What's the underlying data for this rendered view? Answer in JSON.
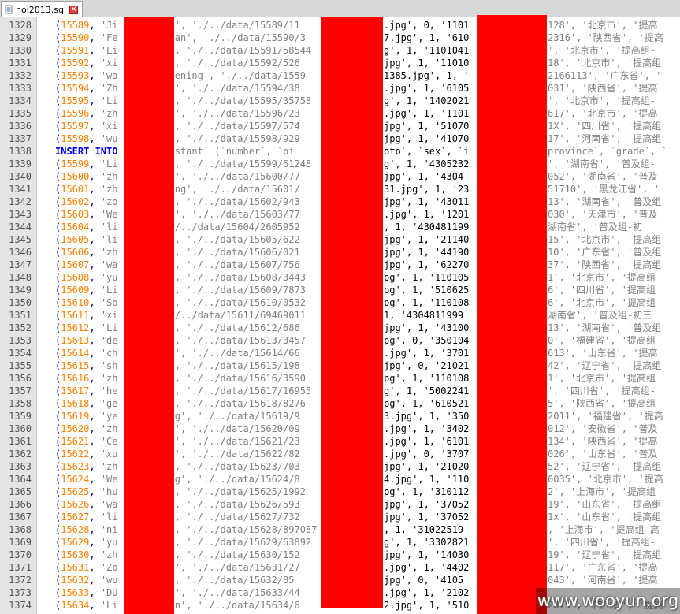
{
  "tab": {
    "label": "noi2013.sql",
    "doc_icon": "document-icon",
    "close_icon": "close-icon"
  },
  "colors": {
    "number": "#ff8000",
    "string": "#808080",
    "keyword": "#0000ff",
    "text": "#000080",
    "redaction": "#ff0000"
  },
  "watermark": "www.wooyun.org",
  "lines": [
    {
      "n": "1328",
      "id": "15589",
      "name": "'Ji",
      "path": "i', './../data/15589/11",
      "mid": ".jpg', 0, '1101",
      "tail": "128', '北京市', '提高"
    },
    {
      "n": "1329",
      "id": "15590",
      "name": "'Fe",
      "path": "yan', './../data/15590/3",
      "mid": "7.jpg', 1, '610",
      "tail": "2316', '陕西省', '提高"
    },
    {
      "n": "1330",
      "id": "15591",
      "name": "'Li",
      "path": "', './../data/15591/58544",
      "mid": "g', 1, '1101041",
      "tail": "', '北京市', '提高组-"
    },
    {
      "n": "1331",
      "id": "15592",
      "name": "'xi",
      "path": "', './../data/15592/526",
      "mid": "jpg', 1, '11010",
      "tail": "18', '北京市', '提高组"
    },
    {
      "n": "1332",
      "id": "15593",
      "name": "'wa",
      "path": "eening', './../data/1559",
      "mid": "1385.jpg', 1, '",
      "tail": "2166113', '广东省', '"
    },
    {
      "n": "1333",
      "id": "15594",
      "name": "'Zh",
      "path": "n', './../data/15594/38",
      "mid": ".jpg', 1, '6105",
      "tail": "031', '陕西省', '提高"
    },
    {
      "n": "1334",
      "id": "15595",
      "name": "'Li",
      "path": "', './../data/15595/35758",
      "mid": "g', 1, '1402021",
      "tail": "', '北京市', '提高组-"
    },
    {
      "n": "1335",
      "id": "15596",
      "name": "'zh",
      "path": "u', './../data/15596/23",
      "mid": ".jpg', 1, '1101",
      "tail": "617', '北京市', '提高"
    },
    {
      "n": "1336",
      "id": "15597",
      "name": "'xi",
      "path": "', './../data/15597/574",
      "mid": "jpg', 1, '51070",
      "tail": "1X', '四川省', '提高组"
    },
    {
      "n": "1337",
      "id": "15598",
      "name": "'wu",
      "path": "', './../data/15598/929",
      "mid": "jpg', 1, '41070",
      "tail": "17', '河南省', '提高组"
    },
    {
      "n": "1338",
      "insert": "INSERT INTO",
      "path": "testant` (`number`, `pi",
      "mid": "oto`, `sex`, `i",
      "tail": "province`, `grade`, `"
    },
    {
      "n": "1339",
      "id": "15599",
      "name": "'Li",
      "path": "', './../data/15599/61248",
      "mid": "g', 1, '4305232",
      "tail": "', '湖南省', '普及组-"
    },
    {
      "n": "1340",
      "id": "15600",
      "name": "'zh",
      "path": "o', './../data/15600/77",
      "mid": "jpg', 1, '4304",
      "tail": "052', '湖南省', '普及"
    },
    {
      "n": "1341",
      "id": "15601",
      "name": "'zh",
      "path": "eng', './../data/15601/",
      "mid": "31.jpg', 1, '23",
      "tail": "51710', '黑龙江省', '"
    },
    {
      "n": "1342",
      "id": "15602",
      "name": "'zo",
      "path": "', './../data/15602/943",
      "mid": "jpg', 1, '43011",
      "tail": "13', '湖南省', '普及组"
    },
    {
      "n": "1343",
      "id": "15603",
      "name": "'We",
      "path": "n', './../data/15603/77",
      "mid": ".jpg', 1, '1201",
      "tail": "030', '天津市', '普及"
    },
    {
      "n": "1344",
      "id": "15604",
      "name": "'li",
      "path": "./../data/15604/2605952",
      "mid": ", 1, '430481199",
      "tail": "湖南省', '普及组-初"
    },
    {
      "n": "1345",
      "id": "15605",
      "name": "'li",
      "path": "', './../data/15605/622",
      "mid": "jpg', 1, '21140",
      "tail": "15', '北京市', '提高组"
    },
    {
      "n": "1346",
      "id": "15606",
      "name": "'zh",
      "path": "', './../data/15606/021",
      "mid": "jpg', 1, '44190",
      "tail": "10', '广东省', '普及组"
    },
    {
      "n": "1347",
      "id": "15607",
      "name": "'wa",
      "path": "', './../data/15607/756",
      "mid": "jpg', 1, '62270",
      "tail": "37', '陕西省', '提高组"
    },
    {
      "n": "1348",
      "id": "15608",
      "name": "'yu",
      "path": "', './../data/15608/3443",
      "mid": "pg', 1, '110105",
      "tail": "1', '北京市', '提高组"
    },
    {
      "n": "1349",
      "id": "15609",
      "name": "'Li",
      "path": "', './../data/15609/7873",
      "mid": "pg', 1, '510625",
      "tail": "6', '四川省', '提高组"
    },
    {
      "n": "1350",
      "id": "15610",
      "name": "'So",
      "path": "', './../data/15610/0532",
      "mid": "pg', 1, '110108",
      "tail": "6', '北京市', '提高组"
    },
    {
      "n": "1351",
      "id": "15611",
      "name": "'xi",
      "path": "./../data/15611/69469011",
      "mid": "1, '4304811999",
      "tail": "湖南省', '普及组-初三"
    },
    {
      "n": "1352",
      "id": "15612",
      "name": "'Li",
      "path": "', './../data/15612/686",
      "mid": "jpg', 1, '43100",
      "tail": "13', '湖南省', '普及组"
    },
    {
      "n": "1353",
      "id": "15613",
      "name": "'de",
      "path": "', './../data/15613/3457",
      "mid": "pg', 0, '350104",
      "tail": "0', '福建省', '提高组"
    },
    {
      "n": "1354",
      "id": "15614",
      "name": "'ch",
      "path": "a', './../data/15614/66",
      "mid": ".jpg', 1, '3701",
      "tail": "613', '山东省', '提高"
    },
    {
      "n": "1355",
      "id": "15615",
      "name": "'sh",
      "path": "', './../data/15615/198",
      "mid": "jpg', 0, '21021",
      "tail": "42', '辽宁省', '提高组"
    },
    {
      "n": "1356",
      "id": "15616",
      "name": "'zh",
      "path": "', './../data/15616/3590",
      "mid": "pg', 1, '110108",
      "tail": "1', '北京市', '提高组"
    },
    {
      "n": "1357",
      "id": "15617",
      "name": "'he",
      "path": "', './../data/15617/16955",
      "mid": "g', 1, '5002241",
      "tail": "', '四川省', '提高组-"
    },
    {
      "n": "1358",
      "id": "15618",
      "name": "'ge",
      "path": "', './../data/15618/8276",
      "mid": "pg', 1, '610521",
      "tail": "5', '陕西省', '提高组"
    },
    {
      "n": "1359",
      "id": "15619",
      "name": "'ye",
      "path": "ng', './../data/15619/9",
      "mid": "3.jpg', 1, '350",
      "tail": "2011', '福建省', '提高"
    },
    {
      "n": "1360",
      "id": "15620",
      "name": "'zh",
      "path": "g', './../data/15620/09",
      "mid": ".jpg', 1, '3402",
      "tail": "012', '安徽省', '普及"
    },
    {
      "n": "1361",
      "id": "15621",
      "name": "'Ce",
      "path": "g', './../data/15621/23",
      "mid": ".jpg', 1, '6101",
      "tail": "134', '陕西省', '提高"
    },
    {
      "n": "1362",
      "id": "15622",
      "name": "'xu",
      "path": "n', './../data/15622/82",
      "mid": ".jpg', 0, '3707",
      "tail": "026', '山东省', '普及"
    },
    {
      "n": "1363",
      "id": "15623",
      "name": "'zh",
      "path": "', './../data/15623/703",
      "mid": "jpg', 1, '21020",
      "tail": "52', '辽宁省', '提高组"
    },
    {
      "n": "1364",
      "id": "15624",
      "name": "'We",
      "path": "ng', './../data/15624/8",
      "mid": "4.jpg', 1, '110",
      "tail": "0035', '北京市', '提高"
    },
    {
      "n": "1365",
      "id": "15625",
      "name": "'hu",
      "path": "', './../data/15625/1992",
      "mid": "pg', 1, '310112",
      "tail": "2', '上海市', '提高组"
    },
    {
      "n": "1366",
      "id": "15626",
      "name": "'wa",
      "path": "', './../data/15626/593",
      "mid": "jpg', 1, '37052",
      "tail": "19', '山东省', '提高组"
    },
    {
      "n": "1367",
      "id": "15627",
      "name": "'li",
      "path": "', './../data/15627/732",
      "mid": "jpg', 1, '37052",
      "tail": "1x', '山东省', '提高组"
    },
    {
      "n": "1368",
      "id": "15628",
      "name": "'ni",
      "path": "', './../data/15628/897087",
      "mid": ", 1, '31022519",
      "tail": ", '上海市', '提高组-高"
    },
    {
      "n": "1369",
      "id": "15629",
      "name": "'yu",
      "path": "', './../data/15629/63892",
      "mid": "g', 1, '3302821",
      "tail": "', '四川省', '提高组-"
    },
    {
      "n": "1370",
      "id": "15630",
      "name": "'zh",
      "path": "', './../data/15630/152",
      "mid": "jpg', 1, '14030",
      "tail": "19', '辽宁省', '提高组"
    },
    {
      "n": "1371",
      "id": "15631",
      "name": "'Zo",
      "path": "n', './../data/15631/27",
      "mid": ".jpg', 1, '4402",
      "tail": "117', '广东省', '提高"
    },
    {
      "n": "1372",
      "id": "15632",
      "name": "'wu",
      "path": "', './../data/15632/85",
      "mid": "jpg', 0, '4105",
      "tail": "043', '河南省', '提高"
    },
    {
      "n": "1373",
      "id": "15633",
      "name": "'DU",
      "path": "G', './../data/15633/44",
      "mid": ".jpg', 1, '2102",
      "tail": "",
      "watermark_row": true
    },
    {
      "n": "1374",
      "id": "15634",
      "name": "'Li",
      "path": "en', './../data/15634/6",
      "mid": "2.jpg', 1, '510",
      "tail": "2875', '四川省', '提高"
    }
  ]
}
